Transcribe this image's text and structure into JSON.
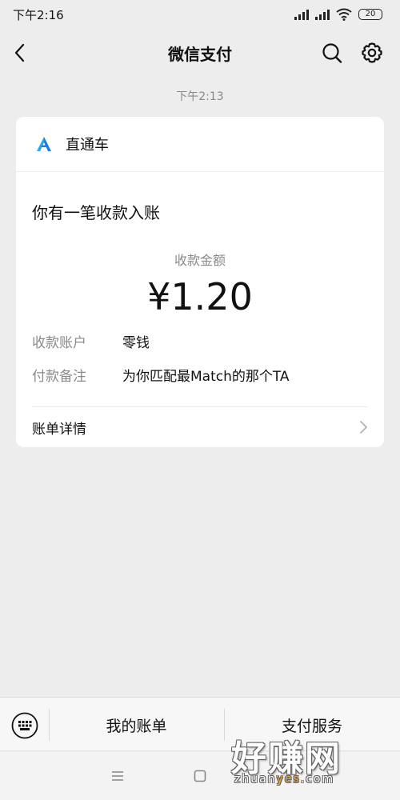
{
  "status_bar": {
    "time": "下午2:16",
    "battery": "20"
  },
  "nav": {
    "title": "微信支付"
  },
  "chat": {
    "timestamp": "下午2:13"
  },
  "card": {
    "source": "直通车",
    "heading": "你有一笔收款入账",
    "amount_label": "收款金额",
    "amount": "¥1.20",
    "details": [
      {
        "key": "收款账户",
        "value": "零钱"
      },
      {
        "key": "付款备注",
        "value": "为你匹配最Match的那个TA"
      }
    ],
    "bill_link": "账单详情"
  },
  "bottom_menu": {
    "items": [
      "我的账单",
      "支付服务"
    ]
  },
  "watermark": {
    "text": "好赚网",
    "url_prefix": "zhuan",
    "url_accent": "yes",
    "url_suffix": ".com"
  },
  "colors": {
    "background": "#ededed",
    "card": "#ffffff",
    "muted_text": "#8a8a8a",
    "logo_blue": "#1f7de0",
    "watermark_accent": "#f3a21f"
  },
  "icons": [
    "back-icon",
    "search-icon",
    "gear-icon",
    "chevron-right-icon",
    "keyboard-icon",
    "menu-lines-icon",
    "home-square-icon"
  ]
}
